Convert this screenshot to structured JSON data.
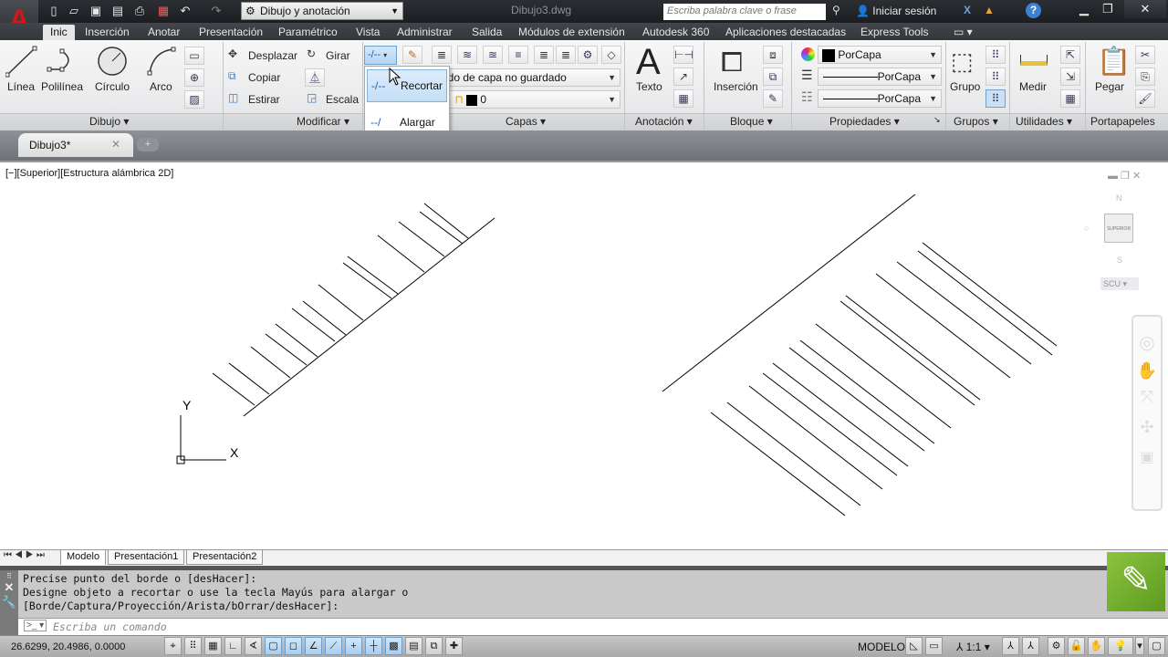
{
  "app": {
    "logo": "A",
    "doc_title": "Dibujo3.dwg"
  },
  "quick_access": {
    "icons": [
      "new-icon",
      "open-icon",
      "save-icon",
      "save-as-icon",
      "print-icon",
      "pdf-icon",
      "undo-icon",
      "redo-icon"
    ],
    "workspace": "Dibujo y anotación"
  },
  "search": {
    "placeholder": "Escriba palabra clave o frase"
  },
  "login": {
    "label": "Iniciar sesión"
  },
  "ribbon_tabs": [
    "Inic",
    "Inserción",
    "Anotar",
    "Presentación",
    "Paramétrico",
    "Vista",
    "Administrar",
    "Salida",
    "Módulos de extensión",
    "Autodesk 360",
    "Aplicaciones destacadas",
    "Express Tools"
  ],
  "active_tab": "Inic",
  "dibujo": {
    "linea": "Línea",
    "polilinea": "Polilínea",
    "circulo": "Círculo",
    "arco": "Arco",
    "label": "Dibujo"
  },
  "modificar": {
    "desplazar": "Desplazar",
    "girar": "Girar",
    "copiar": "Copiar",
    "estirar": "Estirar",
    "escala": "Escala",
    "label": "Modificar"
  },
  "trim_menu": {
    "recortar": "Recortar",
    "alargar": "Alargar"
  },
  "capas": {
    "state": "ado de capa no guardado",
    "layer": "0",
    "label": "Capas"
  },
  "anotacion": {
    "texto": "Texto",
    "label": "Anotación"
  },
  "bloque": {
    "insercion": "Inserción",
    "label": "Bloque"
  },
  "propiedades": {
    "color": "PorCapa",
    "linetype": "PorCapa",
    "lineweight": "PorCapa",
    "label": "Propiedades"
  },
  "grupos": {
    "grupo": "Grupo",
    "label": "Grupos"
  },
  "utilidades": {
    "medir": "Medir",
    "label": "Utilidades"
  },
  "portapapeles": {
    "pegar": "Pegar",
    "label": "Portapapeles"
  },
  "doc_tab": {
    "label": "Dibujo3*"
  },
  "viewport": {
    "label": "[−][Superior][Estructura alámbrica 2D]",
    "ucs_x": "X",
    "ucs_y": "Y"
  },
  "viewcube": {
    "face": "SUPERIOR",
    "north": "N",
    "south": "S",
    "ucs": "SCU"
  },
  "layout_tabs": [
    "Modelo",
    "Presentación1",
    "Presentación2"
  ],
  "command": {
    "history": [
      "Precise punto del borde o [desHacer]:",
      "Designe objeto a recortar o use la tecla Mayús para alargar o",
      "[Borde/Captura/Proyección/Arista/bOrrar/desHacer]:"
    ],
    "placeholder": "Escriba un comando"
  },
  "status": {
    "coords": "26.6299, 20.4986, 0.0000",
    "model": "MODELO",
    "scale": "1:1"
  }
}
